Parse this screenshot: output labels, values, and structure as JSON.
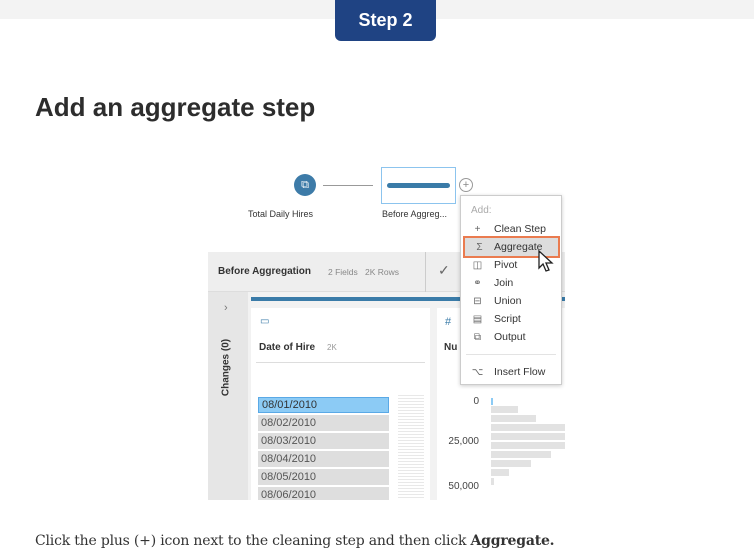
{
  "badge": "Step 2",
  "title": "Add an aggregate step",
  "caption": {
    "text": "Click the plus (+) icon next to the cleaning step and then click ",
    "bold": "Aggregate."
  },
  "flow": {
    "input_label": "Total Daily Hires",
    "step_label": "Before Aggreg..."
  },
  "menu": {
    "header": "Add:",
    "items": [
      {
        "icon": "plus-icon",
        "label": "Clean Step"
      },
      {
        "icon": "sigma-icon",
        "label": "Aggregate",
        "highlighted": true
      },
      {
        "icon": "pivot-icon",
        "label": "Pivot"
      },
      {
        "icon": "join-icon",
        "label": "Join"
      },
      {
        "icon": "union-icon",
        "label": "Union"
      },
      {
        "icon": "script-icon",
        "label": "Script"
      },
      {
        "icon": "output-icon",
        "label": "Output"
      }
    ],
    "insert_flow": "Insert Flow",
    "highlight_color": "#ea7b4f"
  },
  "panel": {
    "title": "Before Aggregation",
    "fields": "2 Fields",
    "rows": "2K Rows",
    "changes": "Changes (0)"
  },
  "field1": {
    "name": "Date of Hire",
    "count": "2K",
    "values": [
      "08/01/2010",
      "08/02/2010",
      "08/03/2010",
      "08/04/2010",
      "08/05/2010",
      "08/06/2010"
    ]
  },
  "field2": {
    "name": "Nu",
    "ticks": [
      "0",
      "25,000",
      "50,000"
    ]
  },
  "colors": {
    "badge": "#1f4383",
    "accent": "#3a7ba8"
  }
}
